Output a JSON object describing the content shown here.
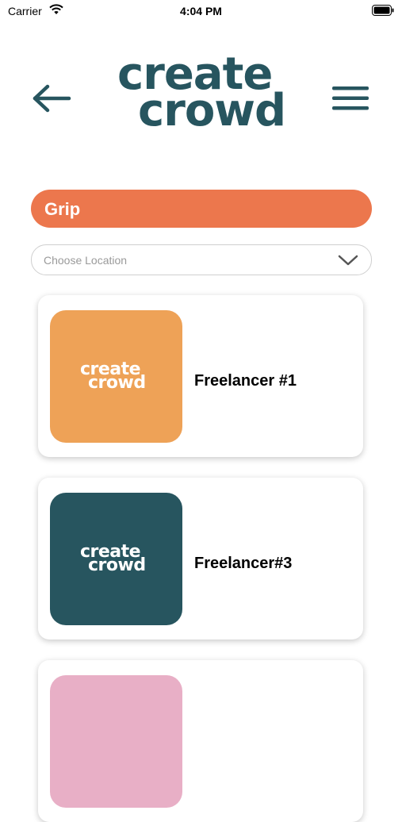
{
  "status_bar": {
    "carrier": "Carrier",
    "time": "4:04 PM"
  },
  "header": {
    "logo_line1": "create",
    "logo_line2": "crowd",
    "back_icon": "arrow-left-icon",
    "menu_icon": "hamburger-menu-icon",
    "brand_color": "#27555f"
  },
  "category": {
    "label": "Grip",
    "color": "#ec774d"
  },
  "location": {
    "placeholder": "Choose Location",
    "icon": "chevron-down-icon"
  },
  "freelancers": [
    {
      "name": "Freelancer #1",
      "thumb_color": "#eea257",
      "thumb_logo_line1": "create",
      "thumb_logo_line2": "crowd"
    },
    {
      "name": "Freelancer#3",
      "thumb_color": "#27555f",
      "thumb_logo_line1": "create",
      "thumb_logo_line2": "crowd"
    },
    {
      "name": "",
      "thumb_color": "#e8afc6"
    }
  ]
}
